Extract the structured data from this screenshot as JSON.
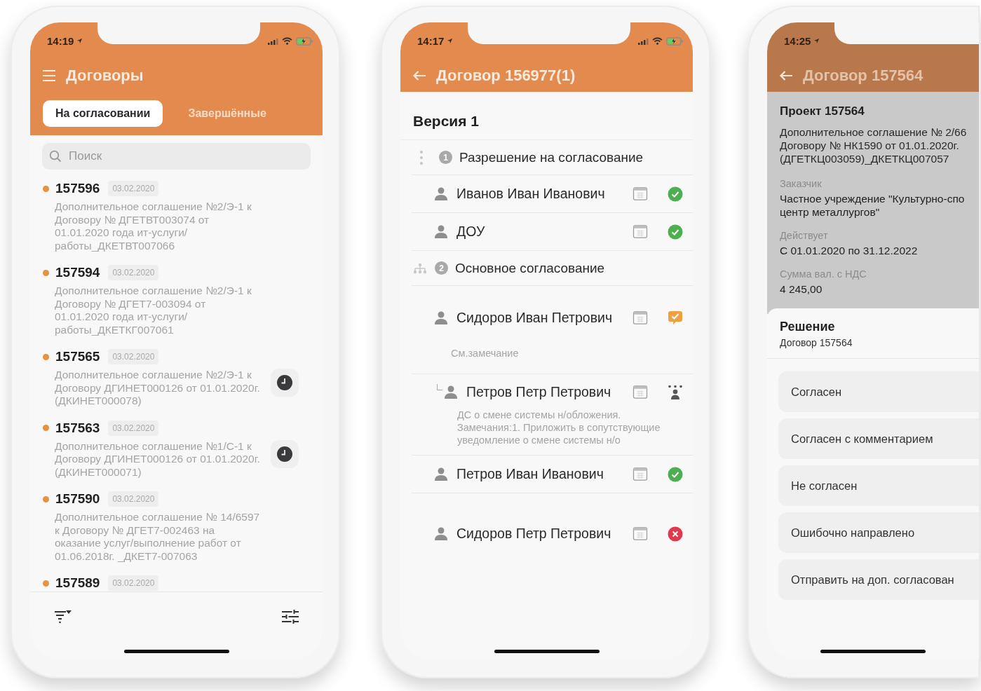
{
  "phones": [
    {
      "kind": "list",
      "time": "14:19",
      "indicators": true,
      "dimmed": false,
      "nav": {
        "kind": "menu"
      },
      "title": "Договоры",
      "tabs": [
        {
          "label": "На согласовании",
          "selected": true
        },
        {
          "label": "Завершённые",
          "selected": false
        }
      ],
      "search": {
        "placeholder": "Поиск"
      },
      "items": [
        {
          "number": "157596",
          "date": "03.02.2020",
          "text": "Дополнительное соглашение №2/Э-1 к Договору № ДГЕТВТ003074 от 01.01.2020 года ит-услуги/ работы_ДКЕТВТ007066",
          "awaiting": false
        },
        {
          "number": "157594",
          "date": "03.02.2020",
          "text": "Дополнительное соглашение №2/Э-1 к Договору № ДГЕТ7-003094 от 01.01.2020 года ит-услуги/ работы_ДКЕТКГ007061",
          "awaiting": false
        },
        {
          "number": "157565",
          "date": "03.02.2020",
          "text": "Дополнительное соглашение №2/Э-1 к Договору ДГИНЕТ000126 от 01.01.2020г.  (ДКИНЕТ000078)",
          "awaiting": true
        },
        {
          "number": "157563",
          "date": "03.02.2020",
          "text": "Дополнительное соглашение №1/С-1 к Договору ДГИНЕТ000126 от 01.01.2020г.  (ДКИНЕТ000071)",
          "awaiting": true
        },
        {
          "number": "157590",
          "date": "03.02.2020",
          "text": "Дополнительное соглашение № 14/6597 к Договору № ДГЕТ7-002463 на оказание услуг/выполнение работ от 01.06.2018г. _ДКЕТ7-007063",
          "awaiting": false
        },
        {
          "number": "157589",
          "date": "03.02.2020",
          "awaiting": false
        }
      ]
    },
    {
      "kind": "approval",
      "time": "14:17",
      "indicators": true,
      "dimmed": false,
      "nav": {
        "kind": "back"
      },
      "title": "Договор 156977(1)",
      "version": "Версия 1",
      "rows": [
        {
          "kind": "sequential-stage",
          "number": "1",
          "label": "Разрешение на согласование"
        },
        {
          "kind": "person",
          "name": "Иванов Иван Иванович",
          "status": {
            "kind": "approved"
          }
        },
        {
          "kind": "person",
          "name": "ДОУ",
          "status": {
            "kind": "approved"
          }
        },
        {
          "kind": "parallel-stage",
          "number": "2",
          "label": "Основное согласование"
        },
        {
          "kind": "person",
          "name": "Сидоров Иван Петрович",
          "status": {
            "kind": "commented"
          },
          "comment": "См.замечание",
          "children": [
            {
              "kind": "person",
              "name": "Петров Петр Петрович",
              "status": {
                "kind": "delegated"
              },
              "comment": "ДС о смене системы н/обложения. Замечания:1. Приложить в сопутствующие уведомление о смене системы н/о"
            }
          ]
        },
        {
          "kind": "person",
          "name": "Петров Иван Иванович",
          "status": {
            "kind": "approved"
          }
        },
        {
          "kind": "person",
          "name": "Сидоров Петр Петрович",
          "status": {
            "kind": "rejected"
          }
        }
      ]
    },
    {
      "kind": "decision",
      "time": "14:25",
      "indicators": false,
      "dimmed": true,
      "nav": {
        "kind": "back"
      },
      "title": "Договор 157564",
      "project": {
        "title": "Проект 157564",
        "text": "Дополнительное соглашение № 2/66 Договору № НК1590 от 01.01.2020г. (ДГЕТКЦ003059)_ДКЕТКЦ007057",
        "fields": [
          {
            "label": "Заказчик",
            "value": "Частное учреждение \"Культурно-спо центр металлургов\""
          },
          {
            "label": "Действует",
            "value": "С 01.01.2020 по 31.12.2022"
          },
          {
            "label": "Сумма вал. с НДС",
            "value": "4 245,00"
          }
        ]
      },
      "sheet": {
        "title": "Решение",
        "subtitle": "Договор 157564",
        "options": [
          "Согласен",
          "Согласен с комментарием",
          "Не согласен",
          "Ошибочно направлено",
          "Отправить на доп. согласован"
        ]
      }
    }
  ]
}
